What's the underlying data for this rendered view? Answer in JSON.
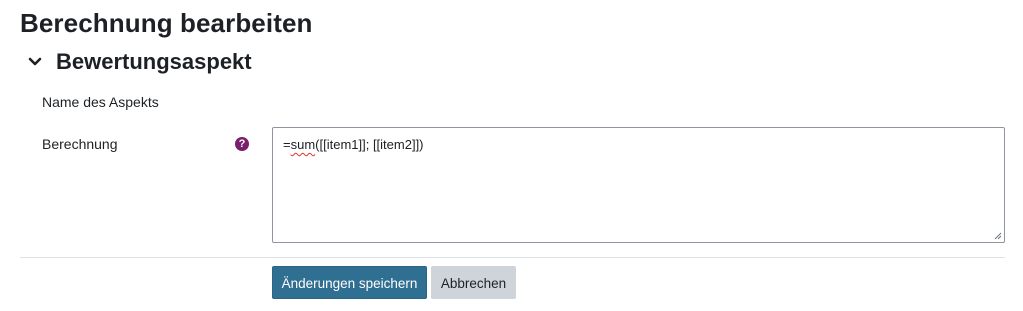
{
  "page": {
    "title": "Berechnung bearbeiten"
  },
  "section": {
    "title": "Bewertungsaspekt",
    "expanded": true,
    "icon": "chevron-down-icon"
  },
  "form": {
    "name_label": "Name des Aspekts",
    "calculation_label": "Berechnung",
    "help_icon": "question-circle-icon",
    "calculation": {
      "prefix": "=",
      "function": "sum",
      "args": "([[item1]]; [[item2]])"
    }
  },
  "buttons": {
    "save_label": "Änderungen speichern",
    "cancel_label": "Abbrechen"
  },
  "colors": {
    "primary_button": "#2f6f91",
    "secondary_button": "#ced4da",
    "help_icon": "#7a1f6c",
    "text": "#1d2125"
  }
}
